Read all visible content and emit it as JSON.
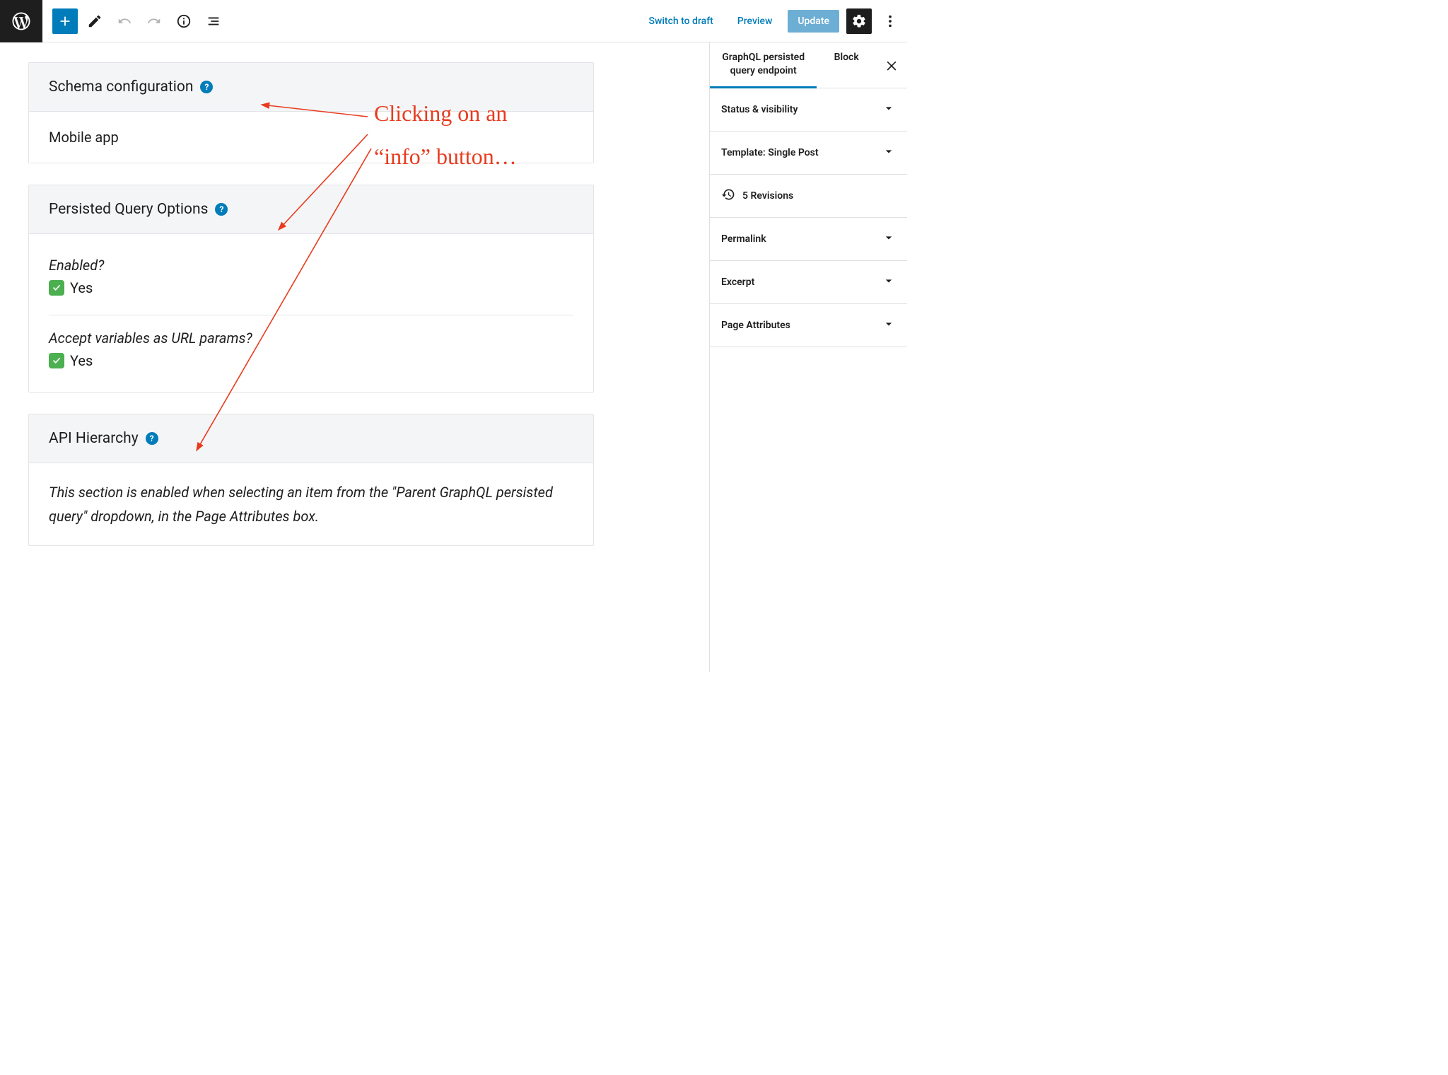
{
  "topbar": {
    "switch_to_draft": "Switch to draft",
    "preview": "Preview",
    "update": "Update"
  },
  "editor": {
    "panel1": {
      "title": "Schema configuration",
      "body": "Mobile app"
    },
    "panel2": {
      "title": "Persisted Query Options",
      "opt1_label": "Enabled?",
      "opt1_value": "Yes",
      "opt2_label": "Accept variables as URL params?",
      "opt2_value": "Yes"
    },
    "panel3": {
      "title": "API Hierarchy",
      "body": "This section is enabled when selecting an item from the \"Parent GraphQL persisted query\" dropdown, in the Page Attributes box."
    }
  },
  "sidebar": {
    "tab1": "GraphQL persisted query endpoint",
    "tab2": "Block",
    "panels": {
      "status": "Status & visibility",
      "template": "Template: Single Post",
      "revisions": "5 Revisions",
      "permalink": "Permalink",
      "excerpt": "Excerpt",
      "page_attrs": "Page Attributes"
    }
  },
  "annotation": {
    "line1": "Clicking on an",
    "line2": "“info” button…"
  }
}
